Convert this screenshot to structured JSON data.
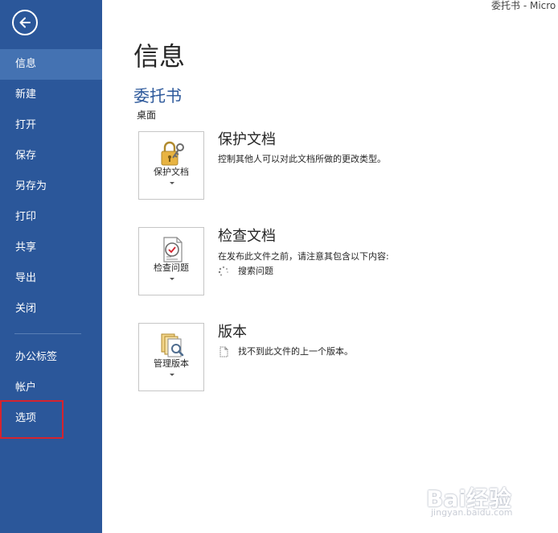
{
  "window": {
    "title": "委托书 - Micro"
  },
  "sidebar": {
    "items": [
      {
        "label": "信息",
        "active": true
      },
      {
        "label": "新建"
      },
      {
        "label": "打开"
      },
      {
        "label": "保存"
      },
      {
        "label": "另存为"
      },
      {
        "label": "打印"
      },
      {
        "label": "共享"
      },
      {
        "label": "导出"
      },
      {
        "label": "关闭"
      },
      {
        "label": "办公标签"
      },
      {
        "label": "帐户"
      },
      {
        "label": "选项",
        "highlighted": true
      }
    ],
    "bg_color": "#2b579a",
    "active_color": "#4472b2",
    "highlight_color": "#d6232e"
  },
  "main": {
    "title": "信息",
    "doc_name": "委托书",
    "doc_path": "桌面",
    "sections": [
      {
        "tile_label": "保护文档",
        "icon": "lock-key-icon",
        "heading": "保护文档",
        "description": "控制其他人可以对此文档所做的更改类型。"
      },
      {
        "tile_label": "检查问题",
        "icon": "inspect-document-icon",
        "heading": "检查文档",
        "description": "在发布此文件之前，请注意其包含以下内容:",
        "sub_item": "搜索问题"
      },
      {
        "tile_label": "管理版本",
        "icon": "manage-versions-icon",
        "heading": "版本",
        "sub_item": "找不到此文件的上一个版本。"
      }
    ]
  },
  "watermark": {
    "brand": "Bai经验",
    "url": "jingyan.baidu.com"
  }
}
